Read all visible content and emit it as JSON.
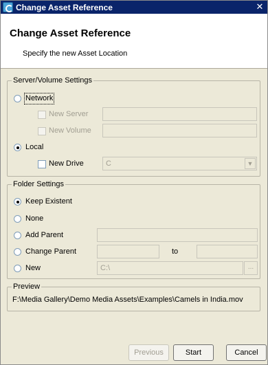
{
  "window": {
    "title": "Change Asset Reference",
    "close_glyph": "✕"
  },
  "header": {
    "title": "Change Asset Reference",
    "subtitle": "Specify the new Asset Location"
  },
  "server_volume": {
    "legend": "Server/Volume Settings",
    "network_label": "Network",
    "new_server_label": "New Server",
    "new_server_value": "",
    "new_volume_label": "New Volume",
    "new_volume_value": "",
    "local_label": "Local",
    "new_drive_label": "New Drive",
    "new_drive_value": "C",
    "selected": "Local"
  },
  "folder": {
    "legend": "Folder Settings",
    "keep_existent_label": "Keep Existent",
    "none_label": "None",
    "add_parent_label": "Add Parent",
    "add_parent_value": "",
    "change_parent_label": "Change Parent",
    "change_parent_from": "",
    "to_label": "to",
    "change_parent_to": "",
    "new_label": "New",
    "new_value": "C:\\",
    "browse_label": "...",
    "selected": "Keep Existent"
  },
  "preview": {
    "legend": "Preview",
    "path": "F:\\Media Gallery\\Demo Media Assets\\Examples\\Camels in India.mov"
  },
  "buttons": {
    "previous": "Previous",
    "start": "Start",
    "cancel": "Cancel"
  },
  "icons": {
    "app": "asset-reference-icon",
    "close": "close-icon",
    "dropdown": "chevron-down-icon"
  }
}
